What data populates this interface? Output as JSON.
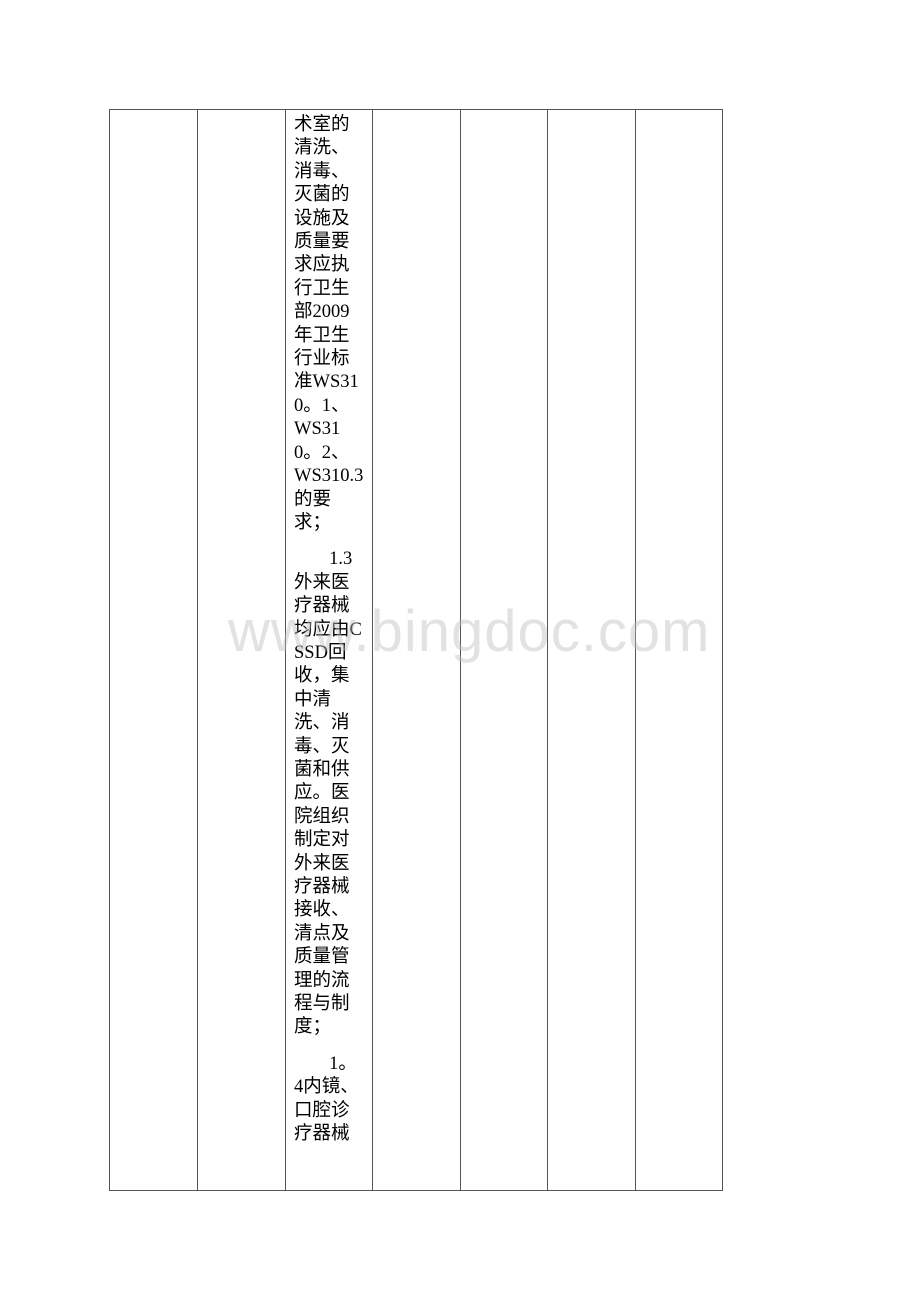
{
  "document": {
    "table": {
      "columns": 7,
      "column3": {
        "paragraphs": [
          "术室的清洗、消毒、灭菌的设施及质量要求应执行卫生部2009年卫生行业标准WS310。1、WS310。2、WS310.3的要求；",
          "1.3外来医疗器械均应由CSSD回收，集中清洗、消毒、灭菌和供应。医院组织制定对外来医疗器械接收、清点及质量管理的流程与制度；",
          "1。4内镜、口腔诊疗器械"
        ]
      },
      "empty_cells": [
        "",
        "",
        "",
        "",
        "",
        ""
      ]
    },
    "watermark": "www.bingdoc.com"
  }
}
